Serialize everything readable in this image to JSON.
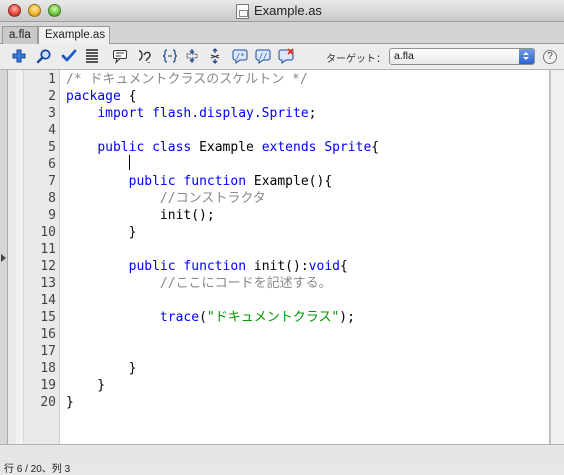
{
  "window": {
    "title": "Example.as"
  },
  "tabs": [
    {
      "label": "a.fla"
    },
    {
      "label": "Example.as"
    }
  ],
  "toolbar": {
    "icons": [
      "add-script-item-icon",
      "find-icon",
      "check-syntax-icon",
      "auto-format-icon",
      "code-hint-icon",
      "debug-options-icon",
      "collapse-braces-icon",
      "collapse-selection-icon",
      "expand-all-icon",
      "apply-block-comment-icon",
      "apply-line-comment-icon",
      "remove-comment-icon"
    ],
    "target_label": "ターゲット：",
    "target_value": "a.fla",
    "help": "?"
  },
  "code": {
    "line_numbers": [
      "1",
      "2",
      "3",
      "4",
      "5",
      "6",
      "7",
      "8",
      "9",
      "10",
      "11",
      "12",
      "13",
      "14",
      "15",
      "16",
      "17",
      "18",
      "19",
      "20"
    ],
    "lines": [
      [
        {
          "t": "/* ドキュメントクラスのスケルトン */",
          "c": "cm"
        }
      ],
      [
        {
          "t": "package",
          "c": "kw"
        },
        {
          "t": " {",
          "c": ""
        }
      ],
      [
        {
          "t": "    ",
          "c": ""
        },
        {
          "t": "import",
          "c": "kw"
        },
        {
          "t": " ",
          "c": ""
        },
        {
          "t": "flash.display.Sprite",
          "c": "kw"
        },
        {
          "t": ";",
          "c": ""
        }
      ],
      [],
      [
        {
          "t": "    ",
          "c": ""
        },
        {
          "t": "public",
          "c": "kw"
        },
        {
          "t": " ",
          "c": ""
        },
        {
          "t": "class",
          "c": "kw"
        },
        {
          "t": " Example ",
          "c": ""
        },
        {
          "t": "extends",
          "c": "kw"
        },
        {
          "t": " ",
          "c": ""
        },
        {
          "t": "Sprite",
          "c": "kw"
        },
        {
          "t": "{",
          "c": ""
        }
      ],
      [],
      [
        {
          "t": "        ",
          "c": ""
        },
        {
          "t": "public",
          "c": "kw"
        },
        {
          "t": " ",
          "c": ""
        },
        {
          "t": "function",
          "c": "kw"
        },
        {
          "t": " Example(){",
          "c": ""
        }
      ],
      [
        {
          "t": "            ",
          "c": ""
        },
        {
          "t": "//コンストラクタ",
          "c": "cm"
        }
      ],
      [
        {
          "t": "            init();",
          "c": ""
        }
      ],
      [
        {
          "t": "        }",
          "c": ""
        }
      ],
      [],
      [
        {
          "t": "        ",
          "c": ""
        },
        {
          "t": "public",
          "c": "kw"
        },
        {
          "t": " ",
          "c": ""
        },
        {
          "t": "function",
          "c": "kw"
        },
        {
          "t": " init():",
          "c": ""
        },
        {
          "t": "void",
          "c": "kw"
        },
        {
          "t": "{",
          "c": ""
        }
      ],
      [
        {
          "t": "            ",
          "c": ""
        },
        {
          "t": "//ここにコードを記述する。",
          "c": "cm"
        }
      ],
      [],
      [
        {
          "t": "            ",
          "c": ""
        },
        {
          "t": "trace",
          "c": "kw"
        },
        {
          "t": "(",
          "c": ""
        },
        {
          "t": "\"ドキュメントクラス\"",
          "c": "st"
        },
        {
          "t": ");",
          "c": ""
        }
      ],
      [],
      [],
      [
        {
          "t": "        }",
          "c": ""
        }
      ],
      [
        {
          "t": "    }",
          "c": ""
        }
      ],
      [
        {
          "t": "}",
          "c": ""
        }
      ]
    ]
  },
  "status": {
    "text": "行 6 / 20、列 3"
  }
}
